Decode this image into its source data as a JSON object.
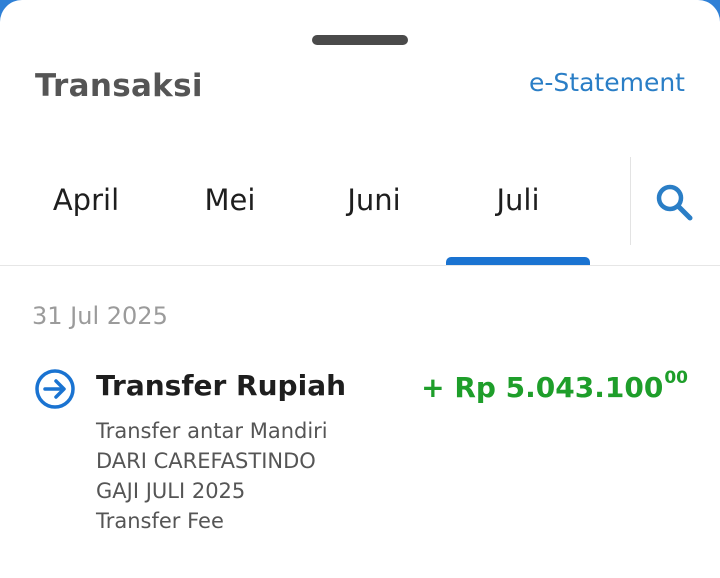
{
  "header": {
    "title": "Transaksi",
    "estatement_label": "e-Statement"
  },
  "tabs": [
    {
      "label": "April",
      "selected": false
    },
    {
      "label": "Mei",
      "selected": false
    },
    {
      "label": "Juni",
      "selected": false
    },
    {
      "label": "Juli",
      "selected": true
    }
  ],
  "search": {
    "icon": "search-icon"
  },
  "transactions": [
    {
      "date": "31 Jul 2025",
      "icon": "transfer-in-icon",
      "title": "Transfer Rupiah",
      "amount_main": "+ Rp 5.043.100",
      "amount_decimals": "00",
      "details": [
        "Transfer antar Mandiri",
        "DARI CAREFASTINDO",
        "GAJI JULI 2025",
        "Transfer Fee"
      ]
    }
  ],
  "colors": {
    "accent": "#1a73d1",
    "link": "#2a7ec6",
    "credit_amount": "#1e9e2a",
    "background_behind_sheet": "#2f80d6"
  }
}
